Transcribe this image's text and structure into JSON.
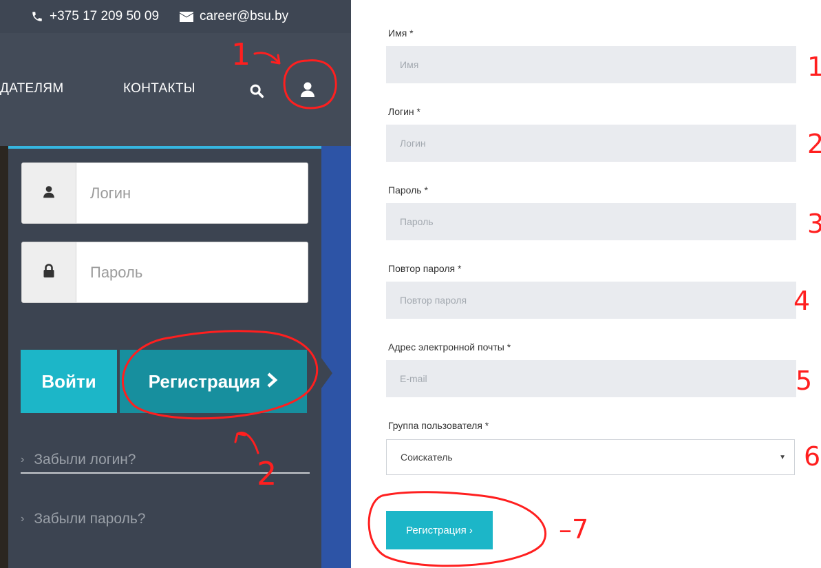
{
  "topbar": {
    "phone": "+375 17 209 50 09",
    "email": "career@bsu.by",
    "phone_icon": "phone-icon",
    "email_icon": "envelope-icon"
  },
  "nav": {
    "employers": "ДАТЕЛЯМ",
    "contacts": "КОНТАКТЫ",
    "search_icon": "search-icon",
    "user_icon": "user-icon"
  },
  "login_panel": {
    "login_placeholder": "Логин",
    "password_placeholder": "Пароль",
    "login_button": "Войти",
    "register_button": "Регистрация",
    "forgot_login": "Забыли логин?",
    "forgot_password": "Забыли пароль?"
  },
  "register_form": {
    "name_label": "Имя *",
    "name_placeholder": "Имя",
    "username_label": "Логин *",
    "username_placeholder": "Логин",
    "password_label": "Пароль *",
    "password_placeholder": "Пароль",
    "password_repeat_label": "Повтор пароля *",
    "password_repeat_placeholder": "Повтор пароля",
    "email_label": "Адрес электронной почты *",
    "email_placeholder": "E-mail",
    "group_label": "Группа пользователя *",
    "group_value": "Соискатель",
    "submit_button": "Регистрация ›"
  },
  "annotations": {
    "left_1": "1",
    "left_2": "2",
    "step_1": "1",
    "step_2": "2",
    "step_3": "3",
    "step_4": "4",
    "step_5": "5",
    "step_6": "6",
    "step_7": "–7"
  },
  "colors": {
    "panel_bg": "#3e4653",
    "accent_teal": "#1cb6c8",
    "accent_dark_teal": "#178f9e",
    "input_bg": "#e9ebef",
    "annotation_red": "#ff1f1f"
  }
}
